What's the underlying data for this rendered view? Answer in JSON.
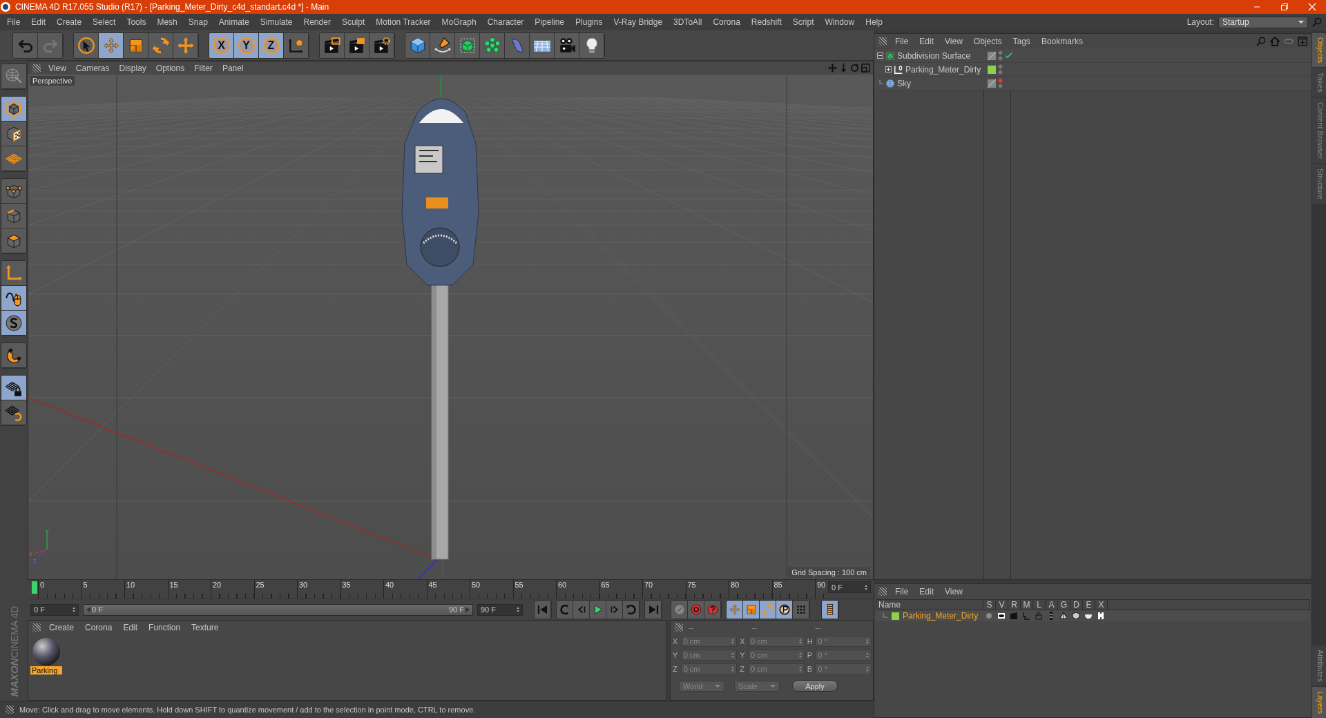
{
  "window": {
    "title": "CINEMA 4D R17.055 Studio (R17) - [Parking_Meter_Dirty_c4d_standart.c4d *] - Main"
  },
  "menu": [
    "File",
    "Edit",
    "Create",
    "Select",
    "Tools",
    "Mesh",
    "Snap",
    "Animate",
    "Simulate",
    "Render",
    "Sculpt",
    "Motion Tracker",
    "MoGraph",
    "Character",
    "Pipeline",
    "Plugins",
    "V-Ray Bridge",
    "3DToAll",
    "Corona",
    "Redshift",
    "Script",
    "Window",
    "Help"
  ],
  "layout": {
    "label": "Layout:",
    "value": "Startup"
  },
  "toolbar": {
    "tools": [
      {
        "kind": "pointer",
        "selected": false
      },
      {
        "kind": "move",
        "selected": true
      },
      {
        "kind": "scale",
        "selected": false
      },
      {
        "kind": "rotate",
        "selected": false
      },
      {
        "kind": "recent",
        "selected": false
      }
    ],
    "axes": [
      {
        "label": "X",
        "selected": true
      },
      {
        "label": "Y",
        "selected": true
      },
      {
        "label": "Z",
        "selected": true
      }
    ]
  },
  "palette": [
    {
      "kind": "model",
      "selected": true
    },
    {
      "kind": "texture",
      "selected": false
    },
    {
      "kind": "workplane",
      "selected": false
    },
    {
      "kind": "points",
      "selected": false
    },
    {
      "kind": "edges",
      "selected": false
    },
    {
      "kind": "polygons",
      "selected": false
    },
    {
      "kind": "axis",
      "selected": false
    },
    {
      "kind": "tweak",
      "selected": true
    },
    {
      "kind": "solo",
      "selected": true
    },
    {
      "kind": "snap",
      "selected": false
    },
    {
      "kind": "lock",
      "selected": true
    },
    {
      "kind": "planar",
      "selected": false
    }
  ],
  "logo": {
    "brand": "MAXON",
    "product": "CINEMA 4D"
  },
  "viewport": {
    "menu": [
      "View",
      "Cameras",
      "Display",
      "Options",
      "Filter",
      "Panel"
    ],
    "camera": "Perspective",
    "grid_spacing": "Grid Spacing : 100 cm",
    "gizmo": [
      "y",
      "x",
      "z"
    ]
  },
  "objects": {
    "menu": [
      "File",
      "Edit",
      "View",
      "Objects",
      "Tags",
      "Bookmarks"
    ],
    "tree": [
      {
        "name": "Subdivision Surface",
        "kind": "generator",
        "expanded": true,
        "enabled": true,
        "editor_hidden": false,
        "children": [
          {
            "name": "Parking_Meter_Dirty",
            "kind": "null",
            "expanded": false,
            "editor_hidden": false,
            "color": "#8fd14f"
          }
        ]
      },
      {
        "name": "Sky",
        "kind": "sky",
        "editor_hidden": true
      }
    ]
  },
  "side_tabs_top": [
    {
      "label": "Objects",
      "selected": true
    },
    {
      "label": "Takes",
      "selected": false
    },
    {
      "label": "Content Browser",
      "selected": false
    },
    {
      "label": "Structure",
      "selected": false
    }
  ],
  "side_tabs_bottom": [
    {
      "label": "Attributes",
      "selected": false
    },
    {
      "label": "Layers",
      "selected": true
    }
  ],
  "timeline": {
    "ticks": [
      "0",
      "5",
      "10",
      "15",
      "20",
      "25",
      "30",
      "35",
      "40",
      "45",
      "50",
      "55",
      "60",
      "65",
      "70",
      "75",
      "80",
      "85",
      "90"
    ],
    "current_frame": "0 F",
    "level": 1,
    "start": "0 F",
    "range_start": "0 F",
    "range_end": "90 F",
    "end": "90 F",
    "key_modes": [
      {
        "kind": "position",
        "selected": true
      },
      {
        "kind": "scale",
        "selected": true
      },
      {
        "kind": "rotation",
        "selected": true
      },
      {
        "kind": "parameter",
        "selected": true
      },
      {
        "kind": "pla",
        "selected": false
      }
    ]
  },
  "materials": {
    "menu": [
      "Create",
      "Corona",
      "Edit",
      "Function",
      "Texture"
    ],
    "items": [
      {
        "name": "Parking",
        "selected": true
      }
    ]
  },
  "coordinates": {
    "headers": [
      "--",
      "--",
      "--"
    ],
    "rows": [
      {
        "label_1": "X",
        "value_1": "0 cm",
        "label_2": "X",
        "value_2": "0 cm",
        "label_3": "H",
        "value_3": "0 °"
      },
      {
        "label_1": "Y",
        "value_1": "0 cm",
        "label_2": "Y",
        "value_2": "0 cm",
        "label_3": "P",
        "value_3": "0 °"
      },
      {
        "label_1": "Z",
        "value_1": "0 cm",
        "label_2": "Z",
        "value_2": "0 cm",
        "label_3": "B",
        "value_3": "0 °"
      }
    ],
    "dropdowns": [
      "World",
      "Scale"
    ],
    "apply": "Apply"
  },
  "layers": {
    "menu": [
      "File",
      "Edit",
      "View"
    ],
    "columns": [
      "Name",
      "S",
      "V",
      "R",
      "M",
      "L",
      "A",
      "G",
      "D",
      "E",
      "X"
    ],
    "rows": [
      {
        "name": "Parking_Meter_Dirty",
        "color": "#8fd14f"
      }
    ]
  },
  "status": "Move: Click and drag to move elements. Hold down SHIFT to quantize movement / add to the selection in point mode, CTRL to remove."
}
